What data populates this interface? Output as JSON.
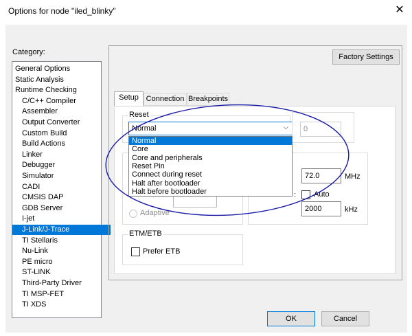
{
  "dialog": {
    "title": "Options for node \"iled_blinky\"",
    "close_glyph": "✕"
  },
  "category": {
    "label": "Category:",
    "items": [
      {
        "label": "General Options",
        "child": false,
        "selected": false
      },
      {
        "label": "Static Analysis",
        "child": false,
        "selected": false
      },
      {
        "label": "Runtime Checking",
        "child": false,
        "selected": false
      },
      {
        "label": "C/C++ Compiler",
        "child": true,
        "selected": false
      },
      {
        "label": "Assembler",
        "child": true,
        "selected": false
      },
      {
        "label": "Output Converter",
        "child": true,
        "selected": false
      },
      {
        "label": "Custom Build",
        "child": true,
        "selected": false
      },
      {
        "label": "Build Actions",
        "child": true,
        "selected": false
      },
      {
        "label": "Linker",
        "child": true,
        "selected": false
      },
      {
        "label": "Debugger",
        "child": true,
        "selected": false
      },
      {
        "label": "Simulator",
        "child": true,
        "selected": false
      },
      {
        "label": "CADI",
        "child": true,
        "selected": false
      },
      {
        "label": "CMSIS DAP",
        "child": true,
        "selected": false
      },
      {
        "label": "GDB Server",
        "child": true,
        "selected": false
      },
      {
        "label": "I-jet",
        "child": true,
        "selected": false
      },
      {
        "label": "J-Link/J-Trace",
        "child": true,
        "selected": true
      },
      {
        "label": "TI Stellaris",
        "child": true,
        "selected": false
      },
      {
        "label": "Nu-Link",
        "child": true,
        "selected": false
      },
      {
        "label": "PE micro",
        "child": true,
        "selected": false
      },
      {
        "label": "ST-LINK",
        "child": true,
        "selected": false
      },
      {
        "label": "Third-Party Driver",
        "child": true,
        "selected": false
      },
      {
        "label": "TI MSP-FET",
        "child": true,
        "selected": false
      },
      {
        "label": "TI XDS",
        "child": true,
        "selected": false
      }
    ]
  },
  "buttons": {
    "factory": "Factory Settings",
    "ok": "OK",
    "cancel": "Cancel"
  },
  "tabs": [
    "Setup",
    "Connection",
    "Breakpoints"
  ],
  "setup": {
    "reset_group": "Reset",
    "reset_value": "Normal",
    "reset_options": [
      "Normal",
      "Core",
      "Core and peripherals",
      "Reset Pin",
      "Connect during reset",
      "Halt after bootloader",
      "Halt before bootloader"
    ],
    "reset_delay": "0",
    "freq_value": "72.0",
    "freq_unit": "MHz",
    "colon": ":",
    "auto_label": "Auto",
    "speed_value": "2000",
    "speed_unit": "kHz",
    "adaptive_label": "Adaptive",
    "etm_group": "ETM/ETB",
    "prefer_etb_label": "Prefer ETB"
  },
  "annotation_color": "#1a1aa8"
}
